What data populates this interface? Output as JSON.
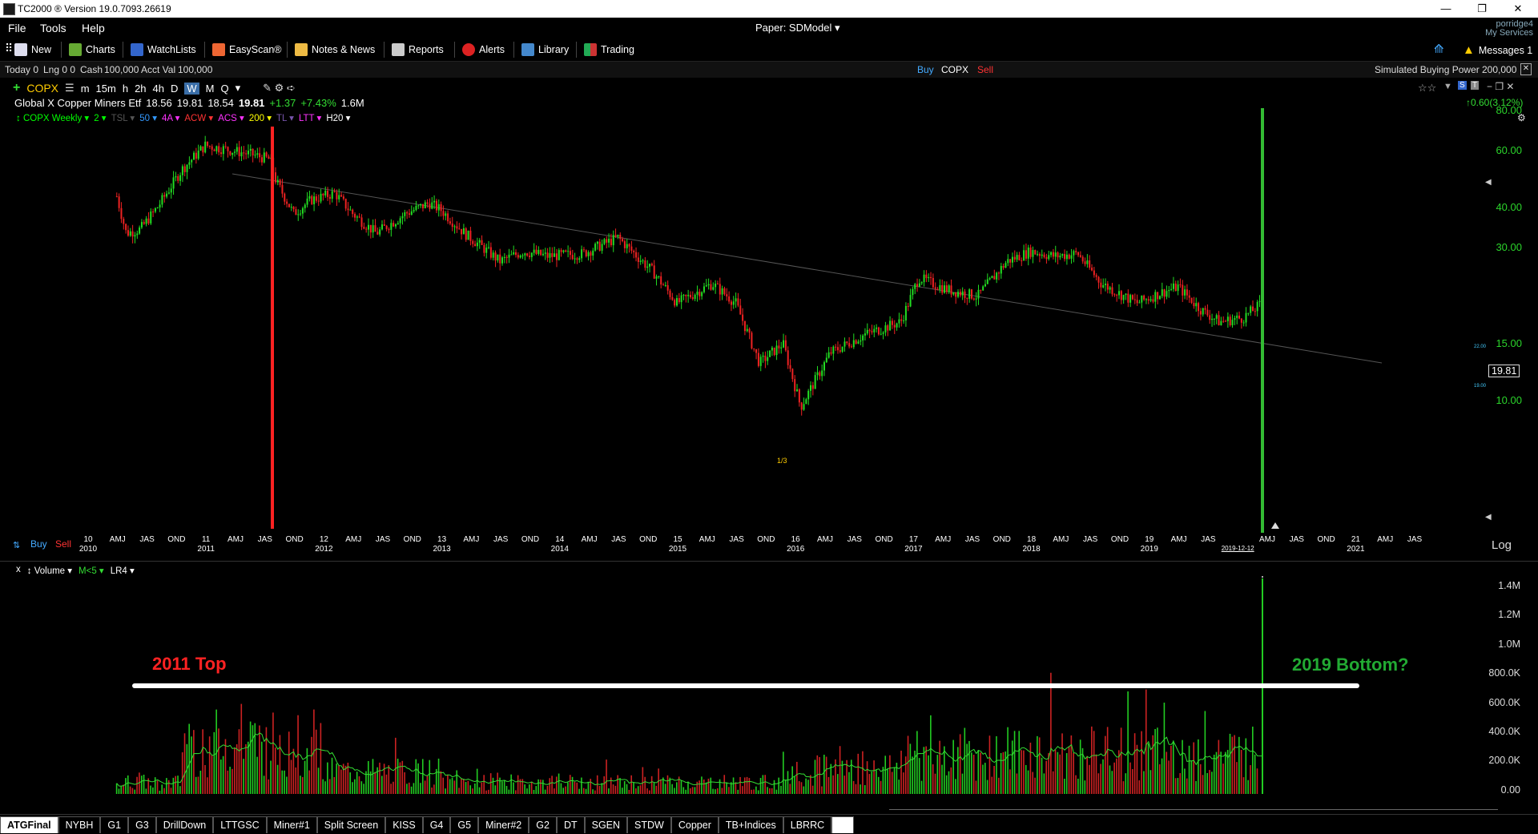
{
  "window": {
    "title": "TC2000 ® Version 19.0.7093.26619",
    "user": "porridge4",
    "my_services": "My Services",
    "messages": "Messages 1"
  },
  "menu": [
    "File",
    "Tools",
    "Help"
  ],
  "account": {
    "label": "Paper: SDModel"
  },
  "toolbar": [
    {
      "label": "New",
      "icon": "new-doc-icon"
    },
    {
      "label": "Charts",
      "icon": "chart-icon"
    },
    {
      "label": "WatchLists",
      "icon": "list-icon"
    },
    {
      "label": "EasyScan®",
      "icon": "scan-icon"
    },
    {
      "label": "Notes & News",
      "icon": "notes-icon"
    },
    {
      "label": "Reports",
      "icon": "report-icon"
    },
    {
      "label": "Alerts",
      "icon": "alarm-icon"
    },
    {
      "label": "Library",
      "icon": "library-icon"
    },
    {
      "label": "Trading",
      "icon": "trading-icon"
    }
  ],
  "status": {
    "today": "Today 0",
    "lng": "Lng 0 0",
    "cash_label": "Cash",
    "cash": "100,000",
    "acct_label": "Acct Val",
    "acct": "100,000",
    "buy": "Buy",
    "symbol": "COPX",
    "sell": "Sell",
    "buying_power_label": "Simulated Buying Power",
    "buying_power": "200,000"
  },
  "symbol": {
    "ticker": "COPX",
    "timeframes": [
      "m",
      "15m",
      "h",
      "2h",
      "4h",
      "D",
      "W",
      "M",
      "Q"
    ],
    "active_timeframe": "W",
    "name": "Global X Copper Miners Etf",
    "open": "18.56",
    "high": "19.81",
    "low": "18.54",
    "close": "19.81",
    "change": "+1.37",
    "change_pct": "+7.43%",
    "volume": "1.6M",
    "day_change": "0.60(3.12%)"
  },
  "indicators": {
    "price": [
      {
        "label": "COPX Weekly",
        "color": "#00ff00"
      },
      {
        "label": "2",
        "color": "#00ff00"
      },
      {
        "label": "TSL",
        "color": "#555555"
      },
      {
        "label": "50",
        "color": "#3399ff"
      },
      {
        "label": "4A",
        "color": "#ff33ff"
      },
      {
        "label": "ACW",
        "color": "#ff3333"
      },
      {
        "label": "ACS",
        "color": "#ff33ff"
      },
      {
        "label": "200",
        "color": "#ffff00"
      },
      {
        "label": "TL",
        "color": "#7755aa"
      },
      {
        "label": "LTT",
        "color": "#ff33ff"
      },
      {
        "label": "H20",
        "color": "#ffffff"
      }
    ],
    "volume": [
      "Volume",
      "M<5",
      "LR4"
    ]
  },
  "chart_data": {
    "type": "candlestick",
    "title": "COPX Weekly",
    "y_scale": "log",
    "y_ticks": [
      "80.00",
      "60.00",
      "40.00",
      "30.00",
      "15.00",
      "10.00"
    ],
    "y_tick_values": [
      80,
      60,
      40,
      30,
      15,
      10
    ],
    "last_price": "19.81",
    "alert_levels": [
      "22.00",
      "19.00"
    ],
    "x_ticks": [
      {
        "m": "10",
        "y": "2010"
      },
      {
        "m": "AMJ"
      },
      {
        "m": "JAS"
      },
      {
        "m": "OND"
      },
      {
        "m": "11",
        "y": "2011"
      },
      {
        "m": "AMJ"
      },
      {
        "m": "JAS"
      },
      {
        "m": "OND"
      },
      {
        "m": "12",
        "y": "2012"
      },
      {
        "m": "AMJ"
      },
      {
        "m": "JAS"
      },
      {
        "m": "OND"
      },
      {
        "m": "13",
        "y": "2013"
      },
      {
        "m": "AMJ"
      },
      {
        "m": "JAS"
      },
      {
        "m": "OND"
      },
      {
        "m": "14",
        "y": "2014"
      },
      {
        "m": "AMJ"
      },
      {
        "m": "JAS"
      },
      {
        "m": "OND"
      },
      {
        "m": "15",
        "y": "2015"
      },
      {
        "m": "AMJ"
      },
      {
        "m": "JAS"
      },
      {
        "m": "OND"
      },
      {
        "m": "16",
        "y": "2016"
      },
      {
        "m": "AMJ"
      },
      {
        "m": "JAS"
      },
      {
        "m": "OND"
      },
      {
        "m": "17",
        "y": "2017"
      },
      {
        "m": "AMJ"
      },
      {
        "m": "JAS"
      },
      {
        "m": "OND"
      },
      {
        "m": "18",
        "y": "2018"
      },
      {
        "m": "AMJ"
      },
      {
        "m": "JAS"
      },
      {
        "m": "OND"
      },
      {
        "m": "19",
        "y": "2019"
      },
      {
        "m": "AMJ"
      },
      {
        "m": "JAS"
      },
      {
        "m": "",
        "y": "2019-12-12"
      },
      {
        "m": "AMJ"
      },
      {
        "m": "JAS"
      },
      {
        "m": "OND"
      },
      {
        "m": "21",
        "y": "2021"
      },
      {
        "m": "AMJ"
      },
      {
        "m": "JAS"
      }
    ],
    "price_path": [
      [
        "2010.25",
        43
      ],
      [
        "2010.33",
        33
      ],
      [
        "2010.45",
        34
      ],
      [
        "2010.6",
        40
      ],
      [
        "2010.8",
        52
      ],
      [
        "2011.0",
        62
      ],
      [
        "2011.2",
        60
      ],
      [
        "2011.4",
        58
      ],
      [
        "2011.55",
        56
      ],
      [
        "2011.6",
        48
      ],
      [
        "2011.75",
        38
      ],
      [
        "2011.9",
        42
      ],
      [
        "2012.1",
        44
      ],
      [
        "2012.25",
        38
      ],
      [
        "2012.45",
        33
      ],
      [
        "2012.7",
        38
      ],
      [
        "2012.9",
        41
      ],
      [
        "2013.0",
        39
      ],
      [
        "2013.2",
        33
      ],
      [
        "2013.5",
        27
      ],
      [
        "2013.7",
        29
      ],
      [
        "2013.9",
        28
      ],
      [
        "2014.2",
        28.5
      ],
      [
        "2014.5",
        32
      ],
      [
        "2014.8",
        25
      ],
      [
        "2015.0",
        20
      ],
      [
        "2015.3",
        23
      ],
      [
        "2015.5",
        20
      ],
      [
        "2015.7",
        13
      ],
      [
        "2015.9",
        15
      ],
      [
        "2016.05",
        9.5
      ],
      [
        "2016.3",
        14
      ],
      [
        "2016.6",
        16
      ],
      [
        "2016.9",
        17.5
      ],
      [
        "2017.05",
        24
      ],
      [
        "2017.3",
        22
      ],
      [
        "2017.55",
        21
      ],
      [
        "2017.8",
        27
      ],
      [
        "2018.0",
        29
      ],
      [
        "2018.2",
        28
      ],
      [
        "2018.4",
        28.5
      ],
      [
        "2018.6",
        23
      ],
      [
        "2018.9",
        20
      ],
      [
        "2019.1",
        21.5
      ],
      [
        "2019.25",
        22.5
      ],
      [
        "2019.45",
        19
      ],
      [
        "2019.6",
        17.5
      ],
      [
        "2019.8",
        18
      ],
      [
        "2019.95",
        19.81
      ]
    ],
    "volume_axis": [
      "1.4M",
      "1.2M",
      "1.0M",
      "800.0K",
      "600.0K",
      "400.0K",
      "200.0K",
      "0.00"
    ],
    "last_volume": 1.6,
    "notes": [
      "2011 Top",
      "2019 Bottom?"
    ],
    "marker_label": "1/3",
    "log_label": "Log"
  },
  "tabs": [
    "ATGFinal",
    "NYBH",
    "G1",
    "G3",
    "DrillDown",
    "LTTGSC",
    "Miner#1",
    "Split Screen",
    "KISS",
    "G4",
    "G5",
    "Miner#2",
    "G2",
    "DT",
    "SGEN",
    "STDW",
    "Copper",
    "TB+Indices",
    "LBRRC"
  ],
  "active_tab": "ATGFinal"
}
